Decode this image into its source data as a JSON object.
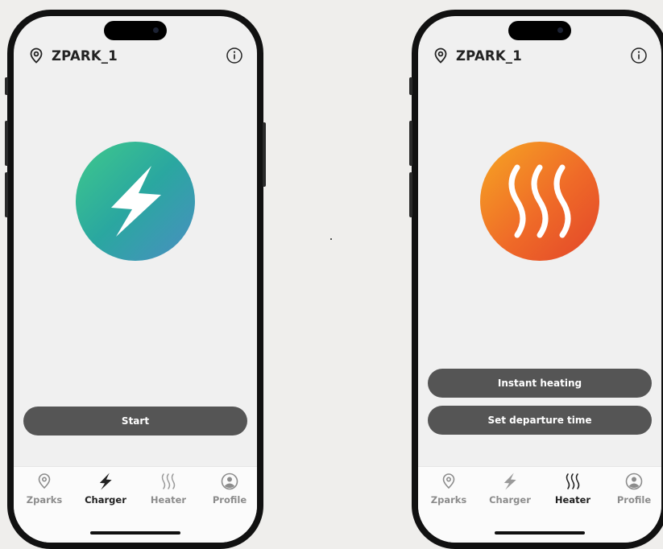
{
  "colors": {
    "button_bg": "#555555",
    "charger_gradient": [
      "#3fc98b",
      "#4a8ec2"
    ],
    "heater_gradient": [
      "#f6a623",
      "#e2452a"
    ]
  },
  "left_phone": {
    "header": {
      "title": "ZPARK_1",
      "location_icon": "map-pin-icon",
      "info_icon": "info-icon"
    },
    "hero_icon": "lightning-bolt-icon",
    "start_button": "Start",
    "tabs": [
      {
        "label": "Zparks",
        "icon": "map-pin-icon",
        "active": false
      },
      {
        "label": "Charger",
        "icon": "lightning-bolt-icon",
        "active": true
      },
      {
        "label": "Heater",
        "icon": "heat-waves-icon",
        "active": false
      },
      {
        "label": "Profile",
        "icon": "user-icon",
        "active": false
      }
    ]
  },
  "right_phone": {
    "header": {
      "title": "ZPARK_1",
      "location_icon": "map-pin-icon",
      "info_icon": "info-icon"
    },
    "hero_icon": "heat-waves-icon",
    "instant_heating_button": "Instant heating",
    "departure_button": "Set departure time",
    "tabs": [
      {
        "label": "Zparks",
        "icon": "map-pin-icon",
        "active": false
      },
      {
        "label": "Charger",
        "icon": "lightning-bolt-icon",
        "active": false
      },
      {
        "label": "Heater",
        "icon": "heat-waves-icon",
        "active": true
      },
      {
        "label": "Profile",
        "icon": "user-icon",
        "active": false
      }
    ]
  }
}
